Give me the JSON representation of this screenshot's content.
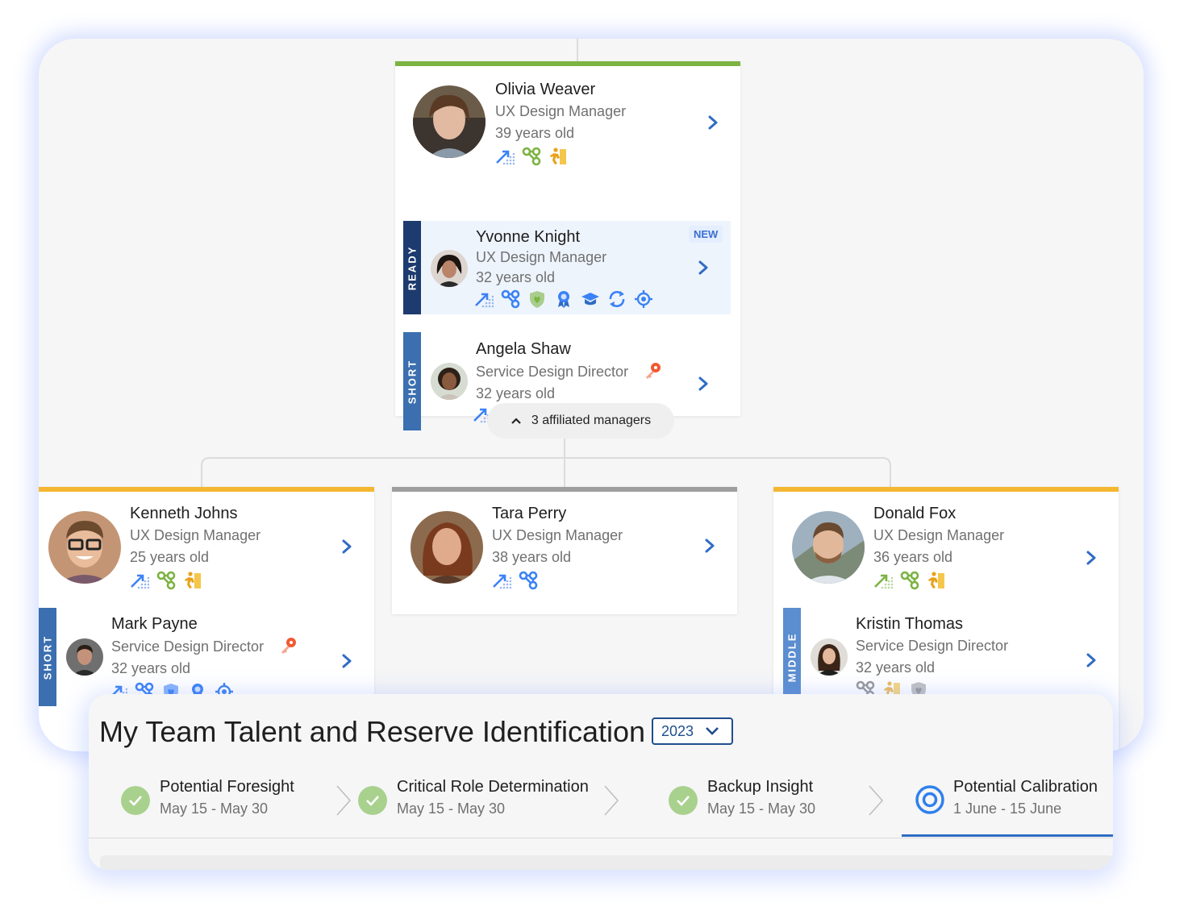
{
  "title": "My Team Talent and Reserve Identification",
  "year_select": {
    "value": "2023"
  },
  "stages": [
    {
      "title": "Potential Foresight",
      "dates": "May 15 - May 30",
      "status": "done"
    },
    {
      "title": "Critical Role Determination",
      "dates": "May 15 - May 30",
      "status": "done"
    },
    {
      "title": "Backup Insight",
      "dates": "May 15 - May 30",
      "status": "done"
    },
    {
      "title": "Potential Calibration",
      "dates": "1 June - 15 June",
      "status": "active"
    }
  ],
  "affiliated_managers": {
    "label": "3 affiliated managers"
  },
  "top_manager": {
    "name": "Olivia Weaver",
    "role": "UX Design Manager",
    "age": "39 years old",
    "icons": [
      "growth-icon",
      "connections-icon",
      "mobility-icon"
    ],
    "bar_color": "#7cb342",
    "successors": [
      {
        "tag": "READY",
        "name": "Yvonne Knight",
        "role": "UX Design Manager",
        "age": "32 years old",
        "badge": "NEW",
        "icons": [
          "growth-icon",
          "connections-icon",
          "shield-heart-icon",
          "award-icon",
          "graduation-cap-icon",
          "refresh-icon",
          "target-icon"
        ]
      },
      {
        "tag": "SHORT",
        "name": "Angela Shaw",
        "role": "Service Design Director",
        "age": "32  years old",
        "has_key": true,
        "icons": [
          "growth-icon",
          "connections-icon",
          "shield-heart-icon",
          "award-icon",
          "target-icon"
        ]
      }
    ]
  },
  "reports": [
    {
      "name": "Kenneth Johns",
      "role": "UX Design Manager",
      "age": "25 years old",
      "bar_color": "#f5b731",
      "icons": [
        "growth-icon",
        "connections-icon",
        "mobility-icon"
      ],
      "successor": {
        "tag": "SHORT",
        "name": "Mark Payne",
        "role": "Service Design Director",
        "age": "32 years old",
        "has_key": true
      }
    },
    {
      "name": "Tara Perry",
      "role": "UX Design Manager",
      "age": "38 years old",
      "bar_color": "#9e9e9e",
      "icons": [
        "growth-icon",
        "connections-icon"
      ]
    },
    {
      "name": "Donald Fox",
      "role": "UX Design Manager",
      "age": "36 years old",
      "bar_color": "#f5b731",
      "icons": [
        "growth-icon",
        "connections-icon",
        "mobility-icon"
      ],
      "successor": {
        "tag": "MIDDLE",
        "name": "Kristin Thomas",
        "role": "Service Design Director",
        "age": "32 years old"
      }
    }
  ],
  "colors": {
    "accent": "#2f6cc4",
    "ready_tag": "#1d3b6e",
    "short_tag": "#3b6fb0",
    "middle_tag": "#5b8ed0",
    "done": "#a9d18e"
  }
}
